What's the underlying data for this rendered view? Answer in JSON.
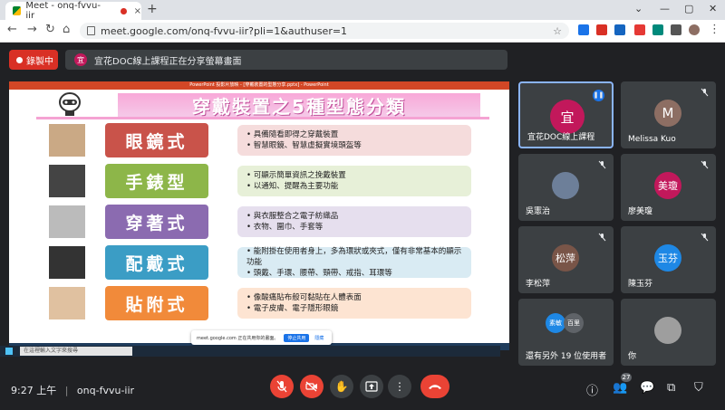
{
  "browser": {
    "tab_title": "Meet - onq-fvvu-iir",
    "tab_close": "×",
    "new_tab": "+",
    "url": "meet.google.com/onq-fvvu-iir?pli=1&authuser=1",
    "window_controls": [
      "⌄",
      "—",
      "▢",
      "✕"
    ]
  },
  "meet": {
    "record_label": "錄製中",
    "presenter_avatar": "宜",
    "presenting_text": "宜花DOC線上課程正在分享螢幕畫面",
    "meeting_code": "onq-fvvu-iir",
    "clock": "9:27 上午",
    "people_count": "27"
  },
  "presentation": {
    "ppt_title": "PowerPoint 投影片放映 - [穿戴裝置的型態分享.pptx] - PowerPoint",
    "slide_title": "穿戴裝置之5種型態分類",
    "rows": [
      {
        "label": "眼鏡式",
        "color": "#c9534a",
        "desc_bg": "#f5dcdc",
        "lines": [
          "具備隨看即得之穿戴裝置",
          "智慧眼鏡、智慧虛擬實境頭盔等"
        ]
      },
      {
        "label": "手錶型",
        "color": "#8db649",
        "desc_bg": "#e7f0d8",
        "lines": [
          "可顯示簡單資訊之挽戴裝置",
          "以通知、提醒為主要功能"
        ]
      },
      {
        "label": "穿著式",
        "color": "#8b6bb0",
        "desc_bg": "#e6dfee",
        "lines": [
          "與衣服整合之電子紡織品",
          "衣物、圍巾、手套等"
        ]
      },
      {
        "label": "配戴式",
        "color": "#3b9dc5",
        "desc_bg": "#d9ebf3",
        "lines": [
          "能附掛在使用者身上，多為環狀或夾式，僅有非常基本的顯示功能",
          "頭戴、手環、腰帶、頸帶、戒指、耳環等"
        ]
      },
      {
        "label": "貼附式",
        "color": "#f18a3a",
        "desc_bg": "#fde4d2",
        "lines": [
          "像酸痛貼布般可黏貼在人體表面",
          "電子皮膚、電子隱形眼鏡"
        ]
      }
    ],
    "taskbar_search": "在這裡輸入文字來搜尋",
    "share_popup_text": "meet.google.com 正在共用你的畫面。",
    "share_stop": "停止共用",
    "share_hide": "隱藏"
  },
  "participants": [
    {
      "name": "宜花DOC線上課程",
      "initial": "宜",
      "color": "#c2185b",
      "active": true
    },
    {
      "name": "Melissa Kuo",
      "initial": "M",
      "color": "#8d6e63",
      "active": false
    },
    {
      "name": "吳憲治",
      "initial": "",
      "color": "#6d7f99",
      "active": false
    },
    {
      "name": "廖美瓊",
      "initial": "美瓊",
      "color": "#c2185b",
      "active": false
    },
    {
      "name": "李松萍",
      "initial": "松萍",
      "color": "#795548",
      "active": false
    },
    {
      "name": "陳玉芬",
      "initial": "玉芬",
      "color": "#1e88e5",
      "active": false
    },
    {
      "name": "還有另外 19 位使用者",
      "initial": "",
      "color": "#1e88e5",
      "active": false
    },
    {
      "name": "你",
      "initial": "",
      "color": "#9e9e9e",
      "active": false
    }
  ],
  "more_avatars": [
    "素敏",
    "百里"
  ]
}
